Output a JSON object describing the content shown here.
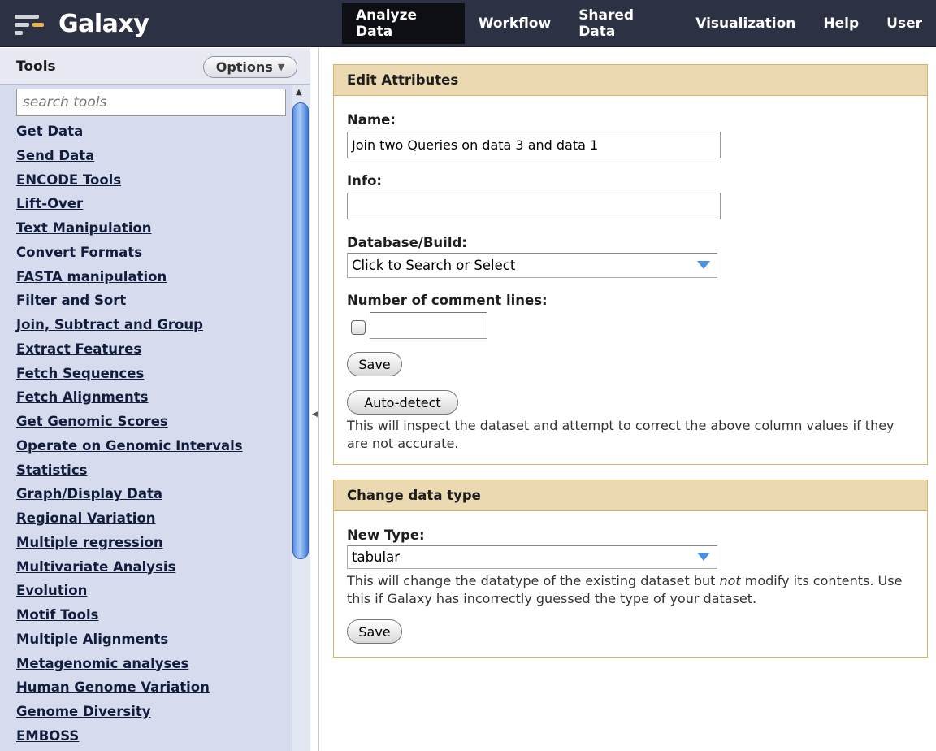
{
  "brand": {
    "name": "Galaxy"
  },
  "nav": {
    "tabs": [
      {
        "label": "Analyze Data",
        "active": true
      },
      {
        "label": "Workflow",
        "active": false
      },
      {
        "label": "Shared Data",
        "active": false
      },
      {
        "label": "Visualization",
        "active": false
      },
      {
        "label": "Help",
        "active": false
      },
      {
        "label": "User",
        "active": false
      }
    ]
  },
  "tools_panel": {
    "title": "Tools",
    "options_label": "Options",
    "search_placeholder": "search tools",
    "items": [
      "Get Data",
      "Send Data",
      "ENCODE Tools",
      "Lift-Over",
      "Text Manipulation",
      "Convert Formats",
      "FASTA manipulation",
      "Filter and Sort",
      "Join, Subtract and Group",
      "Extract Features",
      "Fetch Sequences",
      "Fetch Alignments",
      "Get Genomic Scores",
      "Operate on Genomic Intervals",
      "Statistics",
      "Graph/Display Data",
      "Regional Variation",
      "Multiple regression",
      "Multivariate Analysis",
      "Evolution",
      "Motif Tools",
      "Multiple Alignments",
      "Metagenomic analyses",
      "Human Genome Variation",
      "Genome Diversity",
      "EMBOSS"
    ]
  },
  "edit_attributes": {
    "title": "Edit Attributes",
    "name_label": "Name:",
    "name_value": "Join two Queries on data 3 and data 1",
    "info_label": "Info:",
    "info_value": "",
    "dbkey_label": "Database/Build:",
    "dbkey_value": "Click to Search or Select",
    "comment_lines_label": "Number of comment lines:",
    "save_label": "Save",
    "autodetect_label": "Auto-detect",
    "autodetect_help": "This will inspect the dataset and attempt to correct the above column values if they are not accurate."
  },
  "change_datatype": {
    "title": "Change data type",
    "new_type_label": "New Type:",
    "new_type_value": "tabular",
    "help_before": "This will change the datatype of the existing dataset but ",
    "help_emphasis": "not",
    "help_after": " modify its contents. Use this if Galaxy has incorrectly guessed the type of your dataset.",
    "save_label": "Save"
  }
}
